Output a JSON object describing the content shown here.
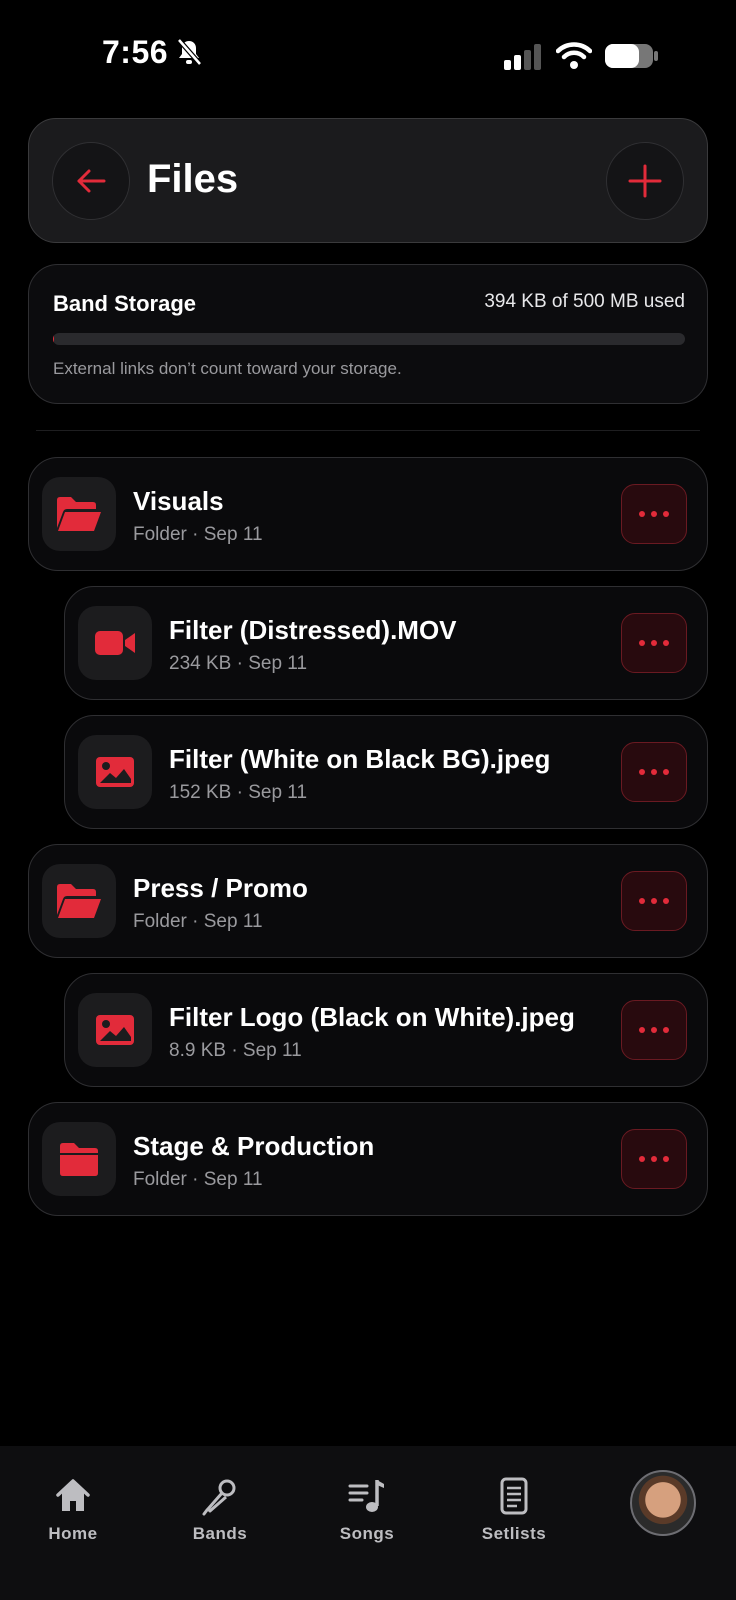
{
  "status_bar": {
    "time": "7:56"
  },
  "header": {
    "title": "Files"
  },
  "storage": {
    "title": "Band Storage",
    "usage": "394 KB of 500 MB used",
    "used_fraction": 0.0008,
    "note": "External links don’t count toward your storage."
  },
  "items": [
    {
      "name": "Visuals",
      "meta": "Folder · Sep 11",
      "type": "folder-open",
      "level": 0
    },
    {
      "name": "Filter (Distressed).MOV",
      "meta": "234 KB · Sep 11",
      "type": "video",
      "level": 1
    },
    {
      "name": "Filter (White on Black BG).jpeg",
      "meta": "152 KB · Sep 11",
      "type": "image",
      "level": 1
    },
    {
      "name": "Press / Promo",
      "meta": "Folder · Sep 11",
      "type": "folder-open",
      "level": 0
    },
    {
      "name": "Filter Logo (Black on White).jpeg",
      "meta": "8.9 KB · Sep 11",
      "type": "image",
      "level": 1
    },
    {
      "name": "Stage & Production",
      "meta": "Folder · Sep 11",
      "type": "folder",
      "level": 0
    }
  ],
  "tabs": [
    {
      "label": "Home",
      "icon": "home-icon"
    },
    {
      "label": "Bands",
      "icon": "microphone-icon"
    },
    {
      "label": "Songs",
      "icon": "music-list-icon"
    },
    {
      "label": "Setlists",
      "icon": "setlist-icon"
    }
  ],
  "colors": {
    "accent": "#e22b3a",
    "background": "#000000",
    "card": "#0a0a0c"
  }
}
